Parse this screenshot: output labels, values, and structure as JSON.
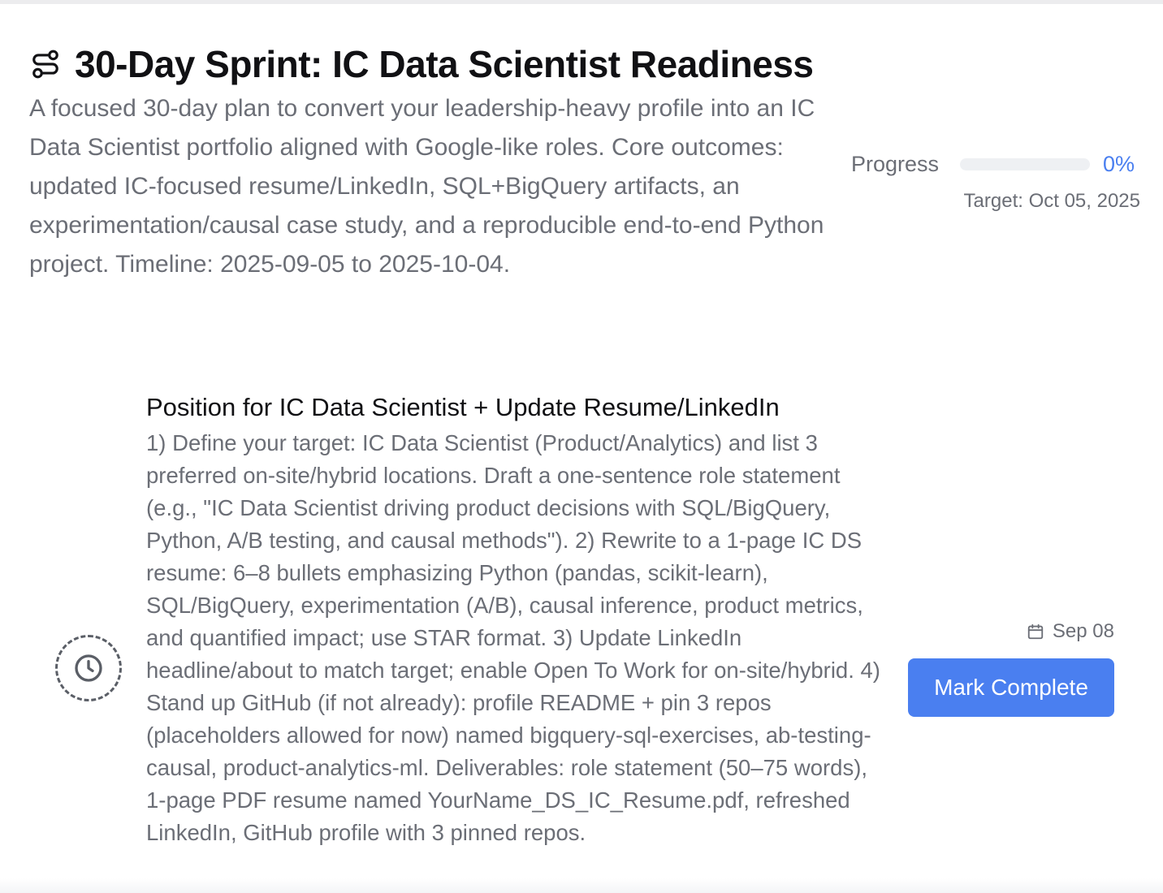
{
  "plan": {
    "title": "30-Day Sprint: IC Data Scientist Readiness",
    "icon": "route-icon",
    "description": "A focused 30-day plan to convert your leadership-heavy profile into an IC Data Scientist portfolio aligned with Google-like roles. Core outcomes: updated IC-focused resume/LinkedIn, SQL+BigQuery artifacts, an experimentation/causal case study, and a reproducible end-to-end Python project. Timeline: 2025-09-05 to 2025-10-04."
  },
  "progress": {
    "label": "Progress",
    "percent": 0,
    "percent_text": "0%",
    "target_text": "Target: Oct 05, 2025",
    "accent_color": "#4a7ff0"
  },
  "task": {
    "status_icon": "clock-icon",
    "title": "Position for IC Data Scientist + Update Resume/LinkedIn",
    "description": "1) Define your target: IC Data Scientist (Product/Analytics) and list 3 preferred on-site/hybrid locations. Draft a one-sentence role statement (e.g., \"IC Data Scientist driving product decisions with SQL/BigQuery, Python, A/B testing, and causal methods\"). 2) Rewrite to a 1-page IC DS resume: 6–8 bullets emphasizing Python (pandas, scikit-learn), SQL/BigQuery, experimentation (A/B), causal inference, product metrics, and quantified impact; use STAR format. 3) Update LinkedIn headline/about to match target; enable Open To Work for on-site/hybrid. 4) Stand up GitHub (if not already): profile README + pin 3 repos (placeholders allowed for now) named bigquery-sql-exercises, ab-testing-causal, product-analytics-ml. Deliverables: role statement (50–75 words), 1-page PDF resume named YourName_DS_IC_Resume.pdf, refreshed LinkedIn, GitHub profile with 3 pinned repos.",
    "due_icon": "calendar-icon",
    "due_date": "Sep 08",
    "button_label": "Mark Complete"
  }
}
